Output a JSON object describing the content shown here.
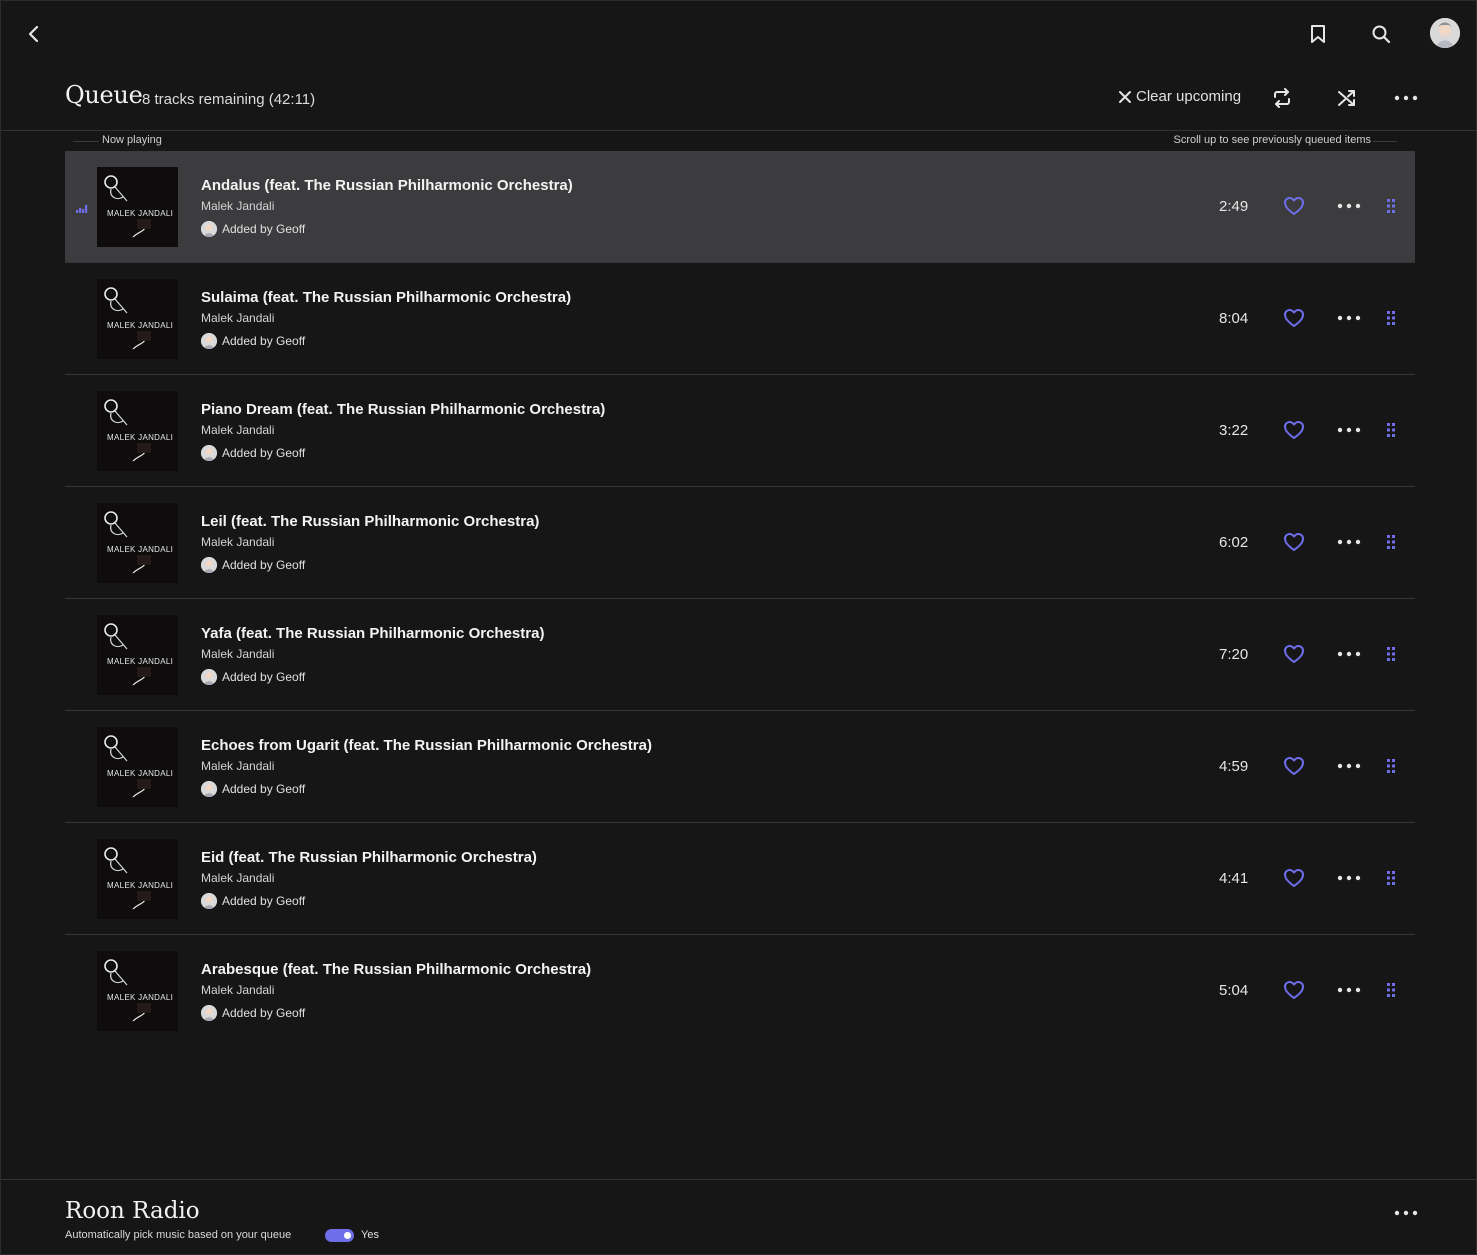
{
  "header": {
    "queue_title": "Queue",
    "queue_subtitle": "8 tracks remaining (42:11)",
    "clear_label": "Clear upcoming",
    "icons": [
      "back-icon",
      "bookmark-icon",
      "search-icon",
      "avatar",
      "close-icon",
      "repeat-icon",
      "shuffle-icon",
      "more-icon"
    ]
  },
  "labels": {
    "now_playing": "Now playing",
    "scroll_hint": "Scroll up to see previously queued items"
  },
  "colors": {
    "accent": "#6d6ee8",
    "background": "#161617",
    "current_row": "#3c3c3f"
  },
  "tracks": [
    {
      "title": "Andalus (feat. The Russian Philharmonic Orchestra)",
      "artist": "Malek Jandali",
      "added_by": "Added by Geoff",
      "duration": "2:49",
      "now_playing": true
    },
    {
      "title": "Sulaima (feat. The Russian Philharmonic Orchestra)",
      "artist": "Malek Jandali",
      "added_by": "Added by Geoff",
      "duration": "8:04",
      "now_playing": false
    },
    {
      "title": "Piano Dream (feat. The Russian Philharmonic Orchestra)",
      "artist": "Malek Jandali",
      "added_by": "Added by Geoff",
      "duration": "3:22",
      "now_playing": false
    },
    {
      "title": "Leil (feat. The Russian Philharmonic Orchestra)",
      "artist": "Malek Jandali",
      "added_by": "Added by Geoff",
      "duration": "6:02",
      "now_playing": false
    },
    {
      "title": "Yafa (feat. The Russian Philharmonic Orchestra)",
      "artist": "Malek Jandali",
      "added_by": "Added by Geoff",
      "duration": "7:20",
      "now_playing": false
    },
    {
      "title": "Echoes from Ugarit (feat. The Russian Philharmonic Orchestra)",
      "artist": "Malek Jandali",
      "added_by": "Added by Geoff",
      "duration": "4:59",
      "now_playing": false
    },
    {
      "title": "Eid (feat. The Russian Philharmonic Orchestra)",
      "artist": "Malek Jandali",
      "added_by": "Added by Geoff",
      "duration": "4:41",
      "now_playing": false
    },
    {
      "title": "Arabesque (feat. The Russian Philharmonic Orchestra)",
      "artist": "Malek Jandali",
      "added_by": "Added by Geoff",
      "duration": "5:04",
      "now_playing": false
    }
  ],
  "album_cover_text": "MALEK JANDALI",
  "radio": {
    "title": "Roon Radio",
    "description": "Automatically pick music based on your queue",
    "toggle_label": "Yes",
    "toggle_on": true
  }
}
